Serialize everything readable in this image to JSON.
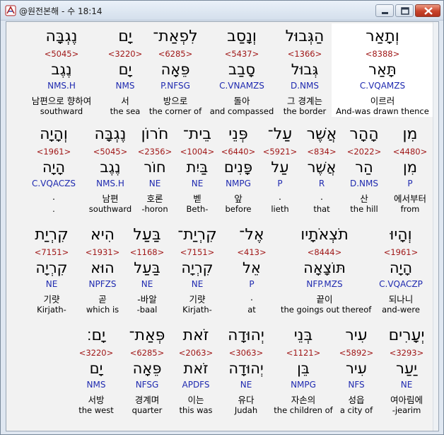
{
  "window": {
    "title": "@원전본해 - 수 18:14"
  },
  "colors": {
    "strongs": "#a01818",
    "parse": "#1f2ab0",
    "selected_bg": "#ffffff"
  },
  "rows": [
    {
      "words": [
        {
          "heb": "וְתָאַר",
          "num": "<8388>",
          "root": "תָּאַר",
          "parse": "C.VQAMZS",
          "kor": "이르러",
          "eng": "And-was drawn thence",
          "selected": true
        },
        {
          "heb": "הַגְּבוּל",
          "num": "<1366>",
          "root": "גְּבוּל",
          "parse": "D.NMS",
          "kor": "그 경계는",
          "eng": "the border"
        },
        {
          "heb": "וְנָסַב",
          "num": "<5437>",
          "root": "סָבַב",
          "parse": "C.VNAMZS",
          "kor": "돌아",
          "eng": "and compassed"
        },
        {
          "heb": "לִפְאַת־",
          "num": "<6285>",
          "root": "פֵּאָה",
          "parse": "P.NFSG",
          "kor": "방으로",
          "eng": "the corner of"
        },
        {
          "heb": "יָם",
          "num": "<3220>",
          "root": "יָם",
          "parse": "NMS",
          "kor": "서",
          "eng": "the sea"
        },
        {
          "heb": "נֶגְבָּה",
          "num": "<5045>",
          "root": "נֶגֶב",
          "parse": "NMS.H",
          "kor": "남편으로 향하여",
          "eng": "southward"
        }
      ]
    },
    {
      "words": [
        {
          "heb": "מִן",
          "num": "<4480>",
          "root": "מִן",
          "parse": "P",
          "kor": "에서부터",
          "eng": "from"
        },
        {
          "heb": "הָהָר",
          "num": "<2022>",
          "root": "הַר",
          "parse": "D.NMS",
          "kor": "산",
          "eng": "the hill"
        },
        {
          "heb": "אֲשֶׁר",
          "num": "<834>",
          "root": "אֲשֶׁר",
          "parse": "R",
          "kor": ".",
          "eng": "that"
        },
        {
          "heb": "עַל־",
          "num": "<5921>",
          "root": "עַל",
          "parse": "P",
          "kor": ".",
          "eng": "lieth"
        },
        {
          "heb": "פְּנֵי",
          "num": "<6440>",
          "root": "פָּנִים",
          "parse": "NMPG",
          "kor": "앞",
          "eng": "before"
        },
        {
          "heb": "בֵית־",
          "num": "<1004>",
          "root": "בַּיִת",
          "parse": "NE",
          "kor": "벧",
          "eng": "Beth-"
        },
        {
          "heb": "חֹרוֹן",
          "num": "<2356>",
          "root": "חוֹר",
          "parse": "NE",
          "kor": "호론",
          "eng": "-horon"
        },
        {
          "heb": "נֶגְבָּה",
          "num": "<5045>",
          "root": "נֶגֶב",
          "parse": "NMS.H",
          "kor": "남편",
          "eng": "southward"
        },
        {
          "heb": "וְהָיָה",
          "num": "<1961>",
          "root": "הָיָה",
          "parse": "C.VQACZS",
          "kor": ".",
          "eng": "."
        }
      ]
    },
    {
      "words": [
        {
          "heb": "וְהָיוּ",
          "num": "<1961>",
          "root": "הָיָה",
          "parse": "C.VQACZP",
          "kor": "되나니",
          "eng": "and-were"
        },
        {
          "heb": "תֹצְאֹתָיו",
          "num": "<8444>",
          "root": "תּוֹצָאָה",
          "parse": "NFP.MZS",
          "kor": "끝이",
          "eng": "the goings out thereof"
        },
        {
          "heb": "אֶל־",
          "num": "<413>",
          "root": "אֵל",
          "parse": "P",
          "kor": ".",
          "eng": "at"
        },
        {
          "heb": "קִרְיַת־",
          "num": "<7151>",
          "root": "קִרְיָה",
          "parse": "NE",
          "kor": "기럇",
          "eng": "Kirjath-"
        },
        {
          "heb": "בַּעַל",
          "num": "<1168>",
          "root": "בַּעַל",
          "parse": "NE",
          "kor": "-바알",
          "eng": "-baal"
        },
        {
          "heb": "הִיא",
          "num": "<1931>",
          "root": "הוּא",
          "parse": "NPFZS",
          "kor": "곧",
          "eng": "which is"
        },
        {
          "heb": "קִרְיַת",
          "num": "<7151>",
          "root": "קִרְיָה",
          "parse": "NE",
          "kor": "기럇",
          "eng": "Kirjath-"
        }
      ]
    },
    {
      "words": [
        {
          "heb": "יְעָרִים",
          "num": "<3293>",
          "root": "יַעַר",
          "parse": "NE",
          "kor": "여아림에",
          "eng": "-jearim"
        },
        {
          "heb": "עִיר",
          "num": "<5892>",
          "root": "עִיר",
          "parse": "NFS",
          "kor": "성읍",
          "eng": "a city of"
        },
        {
          "heb": "בְּנֵי",
          "num": "<1121>",
          "root": "בֵּן",
          "parse": "NMPG",
          "kor": "자손의",
          "eng": "the children of"
        },
        {
          "heb": "יְהוּדָה",
          "num": "<3063>",
          "root": "יְהוּדָה",
          "parse": "NE",
          "kor": "유다",
          "eng": "Judah"
        },
        {
          "heb": "זֹאת",
          "num": "<2063>",
          "root": "זֹאת",
          "parse": "APDFS",
          "kor": "이는",
          "eng": "this was"
        },
        {
          "heb": "פְּאַת־",
          "num": "<6285>",
          "root": "פֵּאָה",
          "parse": "NFSG",
          "kor": "경계며",
          "eng": "quarter"
        },
        {
          "heb": "יָם׃",
          "num": "<3220>",
          "root": "יָם",
          "parse": "NMS",
          "kor": "서방",
          "eng": "the west"
        }
      ]
    }
  ]
}
